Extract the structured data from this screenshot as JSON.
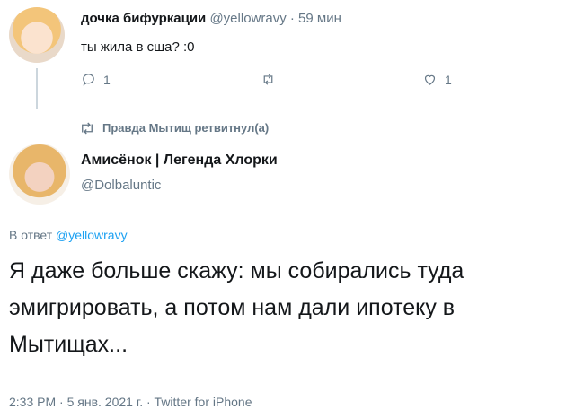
{
  "parent_tweet": {
    "author_name": "дочка бифуркации",
    "handle": "@yellowravy",
    "separator": "·",
    "time": "59 мин",
    "text": "ты жила в сша? :0",
    "reply_count": "1",
    "like_count": "1"
  },
  "retweet_banner": {
    "text": "Правда Мытищ ретвитнул(а)"
  },
  "main_tweet": {
    "author_name": "Амисёнок | Легенда Хлорки",
    "handle": "@Dolbaluntic",
    "reply_prefix": "В ответ",
    "reply_mention": "@yellowravy",
    "text": "Я даже больше скажу: мы собирались туда эмигрировать, а потом нам дали ипотеку в Мытищах...",
    "meta": "2:33 PM · 5 янв. 2021 г. · Twitter for iPhone"
  },
  "colors": {
    "secondary_text": "#657786",
    "link": "#1da1f2",
    "thread_line": "#ccd6dd"
  },
  "icons": [
    "reply-icon",
    "retweet-icon",
    "like-icon"
  ]
}
